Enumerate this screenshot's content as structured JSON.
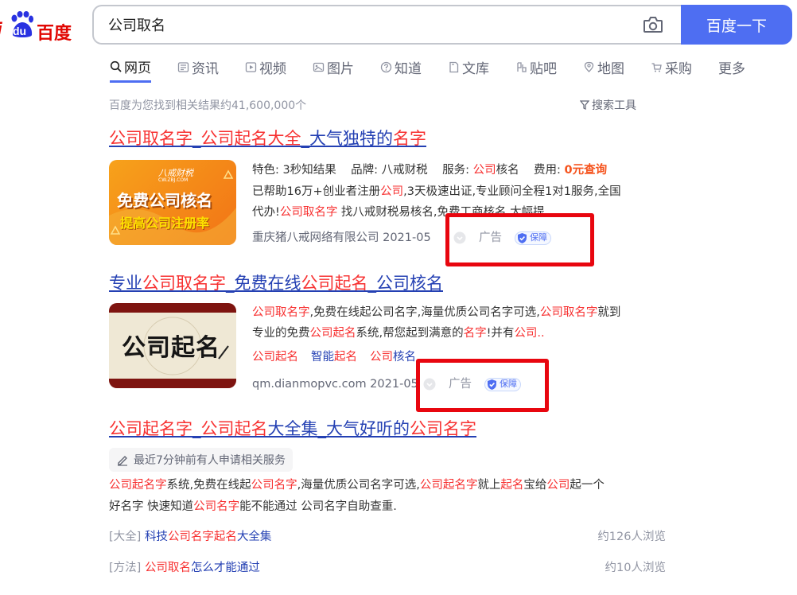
{
  "logo": {
    "bai": "i",
    "du": "du",
    "cn": "百度"
  },
  "search": {
    "query": "公司取名",
    "button": "百度一下"
  },
  "tabs": [
    {
      "label": "网页",
      "icon": "search-icon"
    },
    {
      "label": "资讯",
      "icon": "news-icon"
    },
    {
      "label": "视频",
      "icon": "video-icon"
    },
    {
      "label": "图片",
      "icon": "image-icon"
    },
    {
      "label": "知道",
      "icon": "question-icon"
    },
    {
      "label": "文库",
      "icon": "doc-icon"
    },
    {
      "label": "贴吧",
      "icon": "tieba-icon"
    },
    {
      "label": "地图",
      "icon": "map-icon"
    },
    {
      "label": "采购",
      "icon": "cart-icon"
    },
    {
      "label": "更多",
      "icon": ""
    }
  ],
  "result_count": "百度为您找到相关结果约41,600,000个",
  "tools_label": "搜索工具",
  "result1": {
    "title": [
      {
        "t": "公司取名字",
        "em": true
      },
      {
        "t": "_",
        "em": false
      },
      {
        "t": "公司起名大全",
        "em": true
      },
      {
        "t": "_大气独特的",
        "em": false
      },
      {
        "t": "名字",
        "em": true
      }
    ],
    "thumb": {
      "brand": "八戒财税",
      "domain": "CW.ZBJ.COM",
      "line1": "免费公司核名",
      "line2": "提高公司注册率"
    },
    "l1": [
      {
        "t": "特色: 3秒知结果",
        "c": ""
      },
      {
        "t": "    品牌: 八戒财税",
        "c": ""
      },
      {
        "t": "    服务: ",
        "c": ""
      },
      {
        "t": "公司",
        "c": "em"
      },
      {
        "t": "核名",
        "c": ""
      },
      {
        "t": "    费用: ",
        "c": ""
      },
      {
        "t": "0元查询",
        "c": "orange"
      }
    ],
    "l2": [
      {
        "t": "已帮助16万+创业者注册",
        "c": ""
      },
      {
        "t": "公司",
        "c": "em"
      },
      {
        "t": ",3天极速出证,专业顾问全程1对1服务,全国",
        "c": ""
      }
    ],
    "l3": [
      {
        "t": "代办!",
        "c": ""
      },
      {
        "t": "公司取名字",
        "c": "em"
      },
      {
        "t": " 找八戒财税易核名,免费工商核名,大幅提...",
        "c": ""
      }
    ],
    "source": "重庆猪八戒网络有限公司 2021-05",
    "ad": "广告",
    "bao": "保障"
  },
  "result2": {
    "title": [
      {
        "t": "专业",
        "em": false
      },
      {
        "t": "公司取名字",
        "em": true
      },
      {
        "t": "_免费在线",
        "em": false
      },
      {
        "t": "公司起名",
        "em": true
      },
      {
        "t": "_公司核名",
        "em": false
      }
    ],
    "thumb_text": "公司起名",
    "l1": [
      {
        "t": "公司取名字",
        "c": "em"
      },
      {
        "t": ",免费在线起公司名字,海量优质公司名字可选,",
        "c": ""
      },
      {
        "t": "公司取名字",
        "c": "em"
      },
      {
        "t": "就到",
        "c": ""
      }
    ],
    "l2": [
      {
        "t": "专业的免费",
        "c": ""
      },
      {
        "t": "公司起名",
        "c": "em"
      },
      {
        "t": "系统,帮您起到满意的",
        "c": ""
      },
      {
        "t": "名字",
        "c": "em"
      },
      {
        "t": "!并有",
        "c": ""
      },
      {
        "t": "公司..",
        "c": "em"
      }
    ],
    "links": [
      [
        {
          "t": "公司起名",
          "c": "em"
        }
      ],
      [
        {
          "t": "智能",
          "c": "blue"
        },
        {
          "t": "起名",
          "c": "em"
        }
      ],
      [
        {
          "t": "公司",
          "c": "em"
        },
        {
          "t": "核名",
          "c": "blue"
        }
      ]
    ],
    "source": "qm.dianmopvc.com 2021-05",
    "ad": "广告",
    "bao": "保障"
  },
  "result3": {
    "title": [
      {
        "t": "公司起名字",
        "em": true
      },
      {
        "t": "_",
        "em": false
      },
      {
        "t": "公司起名",
        "em": true
      },
      {
        "t": "大全集_大气好听的",
        "em": false
      },
      {
        "t": "公司名字",
        "em": true
      }
    ],
    "chip": "最近7分钟前有人申请相关服务",
    "l1": [
      {
        "t": "公司起名字",
        "c": "em"
      },
      {
        "t": "系统,免费在线起",
        "c": ""
      },
      {
        "t": "公司名字",
        "c": "em"
      },
      {
        "t": ",海量优质公司名字可选,",
        "c": ""
      },
      {
        "t": "公司起名字",
        "c": "em"
      },
      {
        "t": "就上",
        "c": ""
      },
      {
        "t": "起名",
        "c": "em"
      },
      {
        "t": "宝给",
        "c": ""
      },
      {
        "t": "公司",
        "c": "em"
      },
      {
        "t": "起一个",
        "c": ""
      }
    ],
    "l2": [
      {
        "t": "好名字 快速知道",
        "c": ""
      },
      {
        "t": "公司名字",
        "c": "em"
      },
      {
        "t": "能不能通过 公司名字自助查重.",
        "c": ""
      }
    ],
    "subs": [
      {
        "tag": "[大全]",
        "name": [
          {
            "t": "科技",
            "c": "blue"
          },
          {
            "t": "公司名字起名",
            "c": "em"
          },
          {
            "t": "大全集",
            "c": "blue"
          }
        ],
        "views": "约126人浏览"
      },
      {
        "tag": "[方法]",
        "name": [
          {
            "t": "公司取名",
            "c": "em"
          },
          {
            "t": "怎么才能通过",
            "c": "blue"
          }
        ],
        "views": "约10人浏览"
      }
    ]
  }
}
